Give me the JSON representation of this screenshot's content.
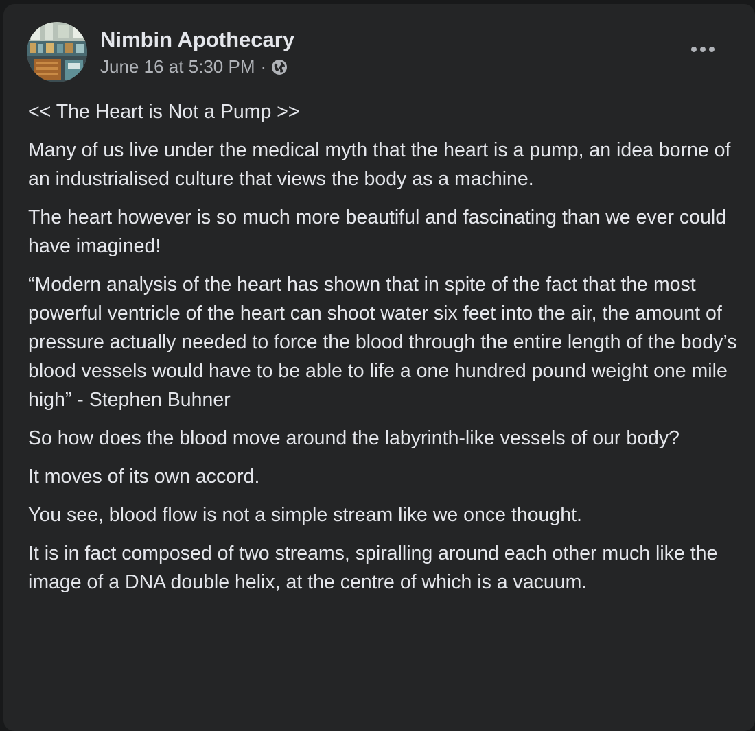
{
  "post": {
    "author": "Nimbin Apothecary",
    "timestamp": "June 16 at 5:30 PM",
    "separator": "·",
    "privacy_icon": "globe-icon",
    "more_icon": "more-options-icon",
    "paragraphs": [
      "<< The Heart is Not a Pump >>",
      "Many of us live under the medical myth that the heart is a pump, an idea borne of an industrialised culture that views the body as a machine.",
      "The heart however is so much more beautiful and fascinating than we ever could have imagined!",
      "“Modern analysis of the heart has shown that in spite of the fact that the most powerful ventricle of the heart can shoot water six feet into the air, the amount of pressure actually needed to force the blood through the entire length of the body’s blood vessels would have to be able to life a one hundred pound weight one mile high” - Stephen Buhner",
      "So how does the blood move around the labyrinth-like vessels of our body?",
      "It moves of its own accord.",
      "You see, blood flow is not a simple stream like we once thought.",
      "It is in fact composed of two streams, spiralling around each other much like the image of a DNA double helix, at the centre of which is a vacuum."
    ]
  },
  "colors": {
    "page_background": "#18191a",
    "card_background": "#242526",
    "primary_text": "#e4e6eb",
    "secondary_text": "#b0b3b8"
  }
}
